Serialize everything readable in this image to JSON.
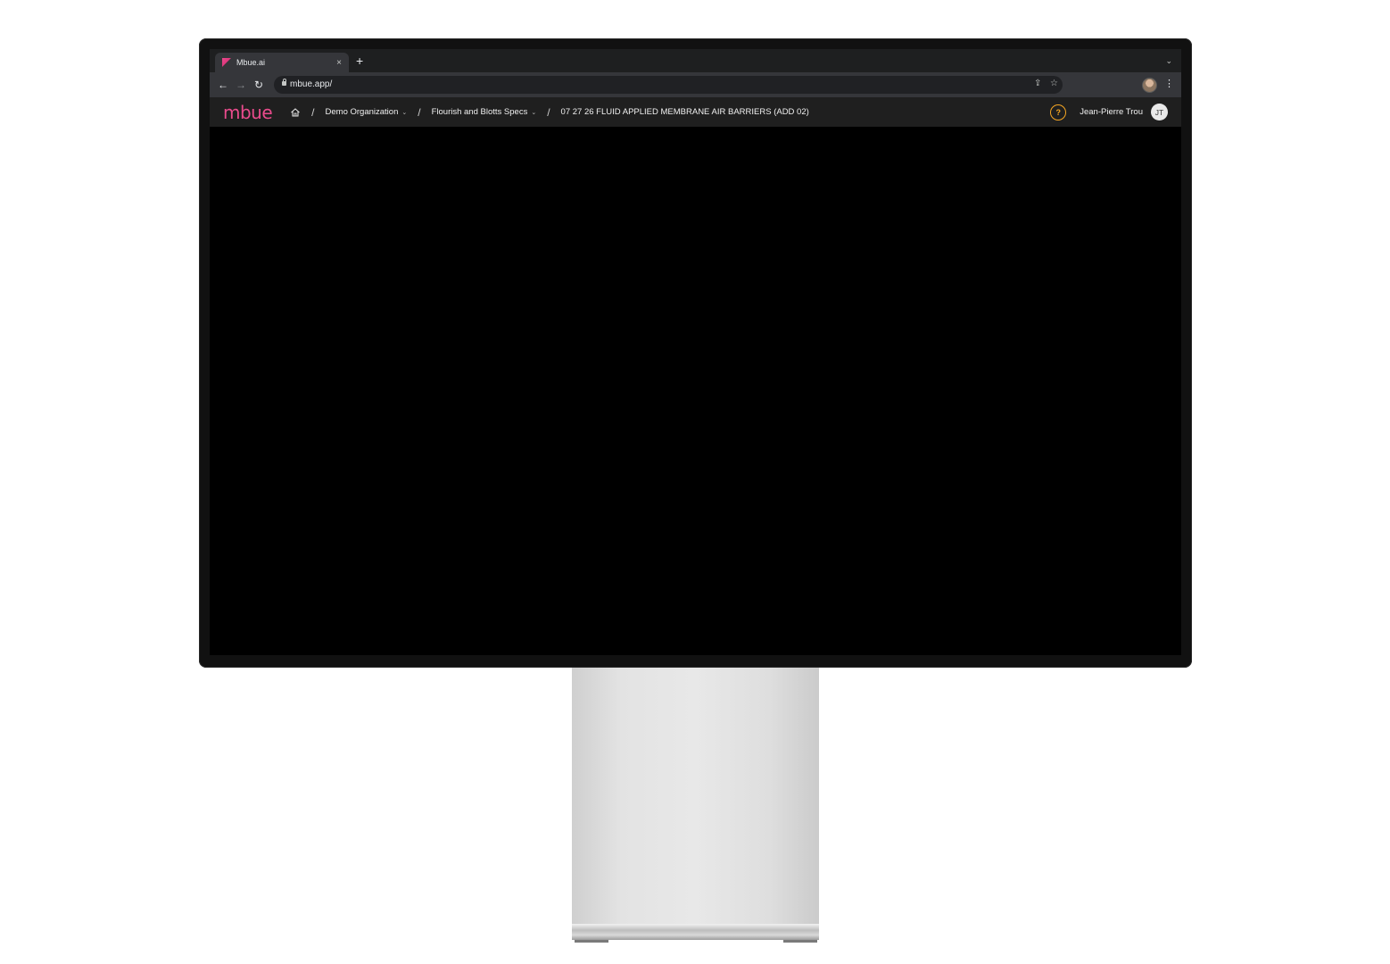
{
  "browser": {
    "tab_title": "Mbue.ai",
    "tab_close": "×",
    "new_tab": "+",
    "tab_menu": "⌄",
    "url": "mbue.app/",
    "back": "←",
    "forward": "→",
    "reload": "↻",
    "share": "⇪",
    "bookmark": "☆",
    "menu": "⋮"
  },
  "app": {
    "logo": "mbue",
    "breadcrumbs": [
      {
        "label": "Demo Organization",
        "chevron": "⌄"
      },
      {
        "label": "Flourish and Blotts Specs",
        "chevron": "⌄"
      }
    ],
    "separator": "/",
    "current_page": "07 27 26 FLUID APPLIED MEMBRANE AIR BARRIERS (ADD 02)",
    "help": "?",
    "user_name": "Jean-Pierre Trou",
    "user_initials": "JT"
  },
  "colors": {
    "brand": "#e94b8c",
    "help_accent": "#f5a623",
    "header_bg": "#1f1f1f",
    "content_bg": "#000000"
  }
}
